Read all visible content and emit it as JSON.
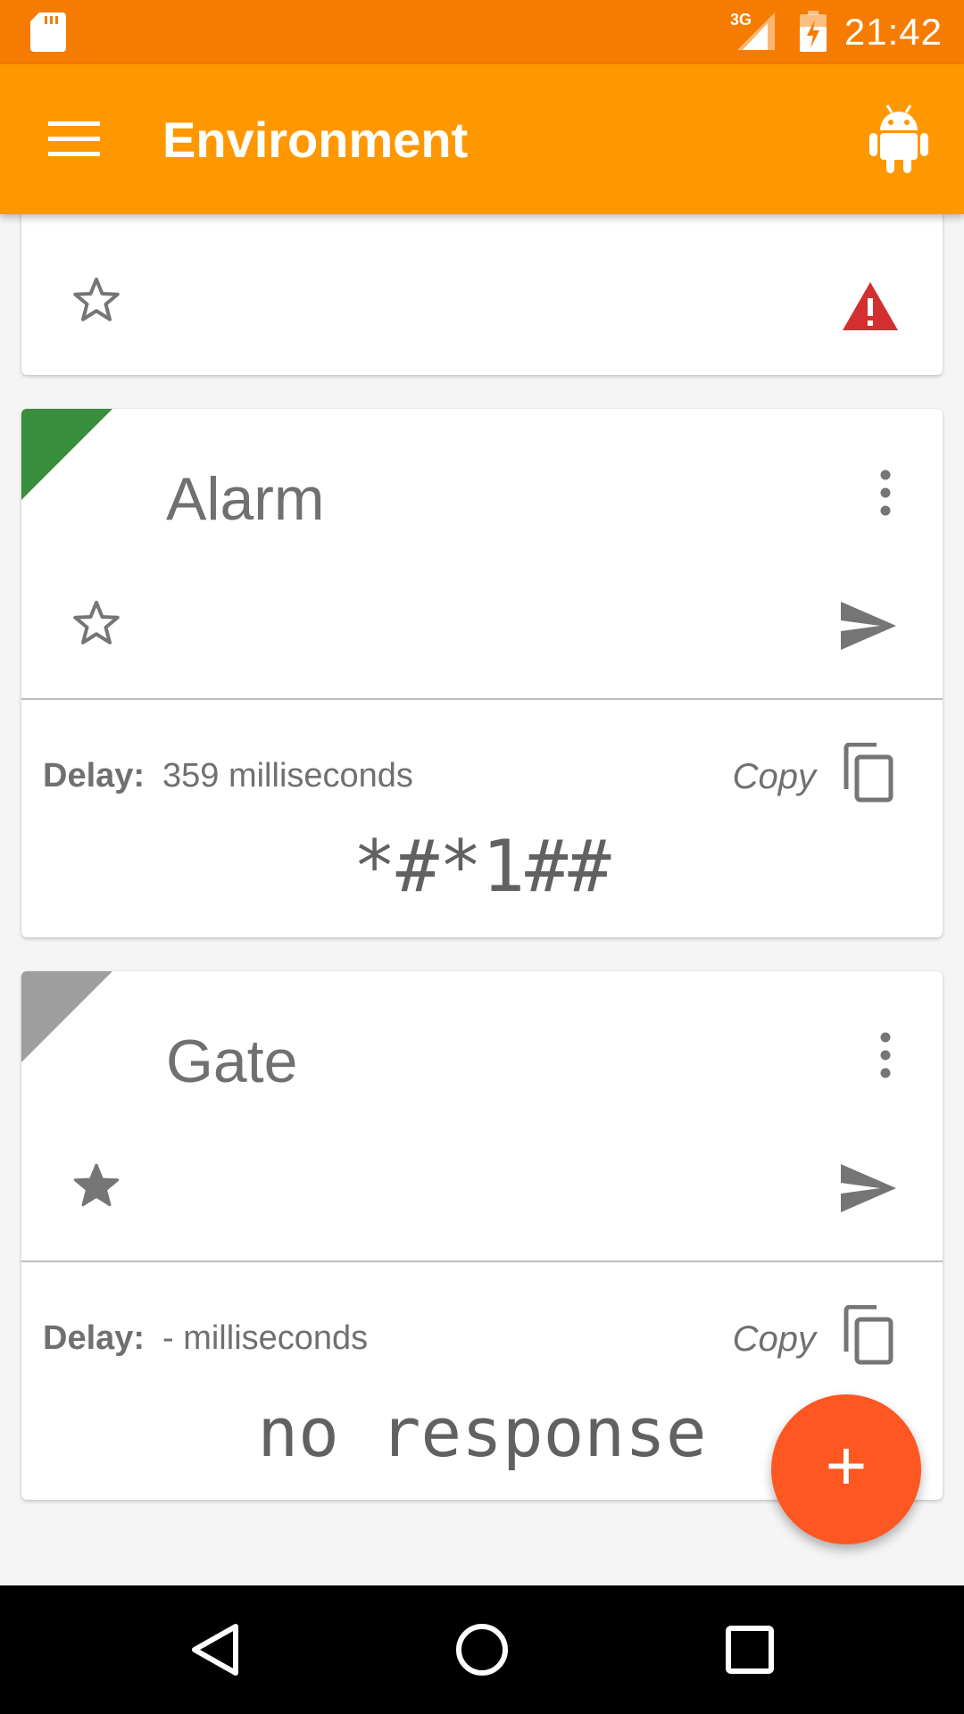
{
  "status_bar": {
    "time": "21:42",
    "network_label": "3G",
    "icons": [
      "sd-card-icon",
      "signal-icon",
      "battery-charging-icon"
    ]
  },
  "app_bar": {
    "title": "Environment",
    "icons": [
      "menu-icon",
      "android-icon"
    ]
  },
  "cards": [
    {
      "name": "",
      "favorite": false,
      "status_icon": "warning-icon",
      "status_color": "#d32f2f"
    },
    {
      "name": "Alarm",
      "corner_color": "#388e3c",
      "favorite": false,
      "delay_label": "Delay:",
      "delay_value": "359 milliseconds",
      "copy_label": "Copy",
      "response": "*#*1##"
    },
    {
      "name": "Gate",
      "corner_color": "#9e9e9e",
      "favorite": true,
      "delay_label": "Delay:",
      "delay_value": "- milliseconds",
      "copy_label": "Copy",
      "response": "no response"
    }
  ],
  "fab": {
    "label": "+",
    "color": "#ff5722"
  },
  "nav_bar": {
    "icons": [
      "back-icon",
      "home-icon",
      "recents-icon"
    ]
  },
  "colors": {
    "status_bar": "#f57c00",
    "app_bar": "#ff9800",
    "accent": "#ff5722"
  }
}
